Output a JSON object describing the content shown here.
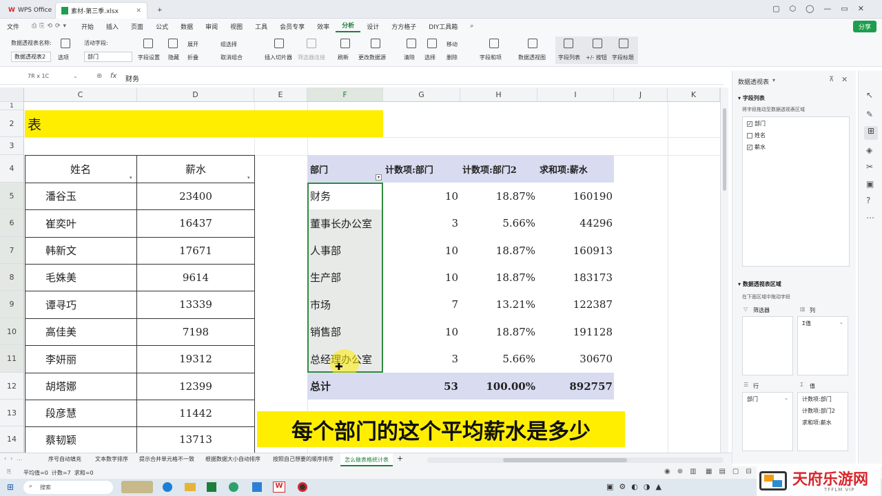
{
  "titlebar": {
    "wps_tab": "WPS Office",
    "file_tab": "素材-第三季.xlsx",
    "add": "+"
  },
  "menubar": {
    "file": "文件",
    "items": [
      "开始",
      "插入",
      "页面",
      "公式",
      "数据",
      "审阅",
      "视图",
      "工具",
      "会员专享",
      "效率",
      "分析",
      "设计",
      "方方格子",
      "DIY工具箱"
    ],
    "share": "分享"
  },
  "ribbon": {
    "pivot_name_label": "数据透视表名称:",
    "pivot_name_value": "数据透视表2",
    "options": "选项",
    "active_field_label": "活动字段:",
    "active_field_value": "部门",
    "field_settings": "字段设置",
    "hide": "隐藏",
    "expand": "展开",
    "collapse": "折叠",
    "group_select": "组选择",
    "ungroup": "取消组合",
    "insert_slicer": "插入切片器",
    "filter_conn": "筛选器连接",
    "refresh": "刷新",
    "change_source": "更改数据源",
    "clear": "清除",
    "select": "选择",
    "move": "移动",
    "delete": "删除",
    "fields_items": "字段和项",
    "pivot_chart": "数据透视图",
    "field_list": "字段列表",
    "plus_minus": "+/- 按钮",
    "field_headers": "字段标题"
  },
  "formula_bar": {
    "name_box": "7R x 1C",
    "fx": "fx",
    "content": "财务"
  },
  "columns": [
    "C",
    "D",
    "E",
    "F",
    "G",
    "H",
    "I",
    "J",
    "K"
  ],
  "rows": [
    "1",
    "2",
    "3",
    "4",
    "5",
    "6",
    "7",
    "8",
    "9",
    "10",
    "11",
    "12",
    "13",
    "14"
  ],
  "sheet": {
    "title_cell": "表",
    "left_headers": [
      "姓名",
      "薪水"
    ],
    "left_rows": [
      [
        "潘谷玉",
        "23400"
      ],
      [
        "崔奕叶",
        "16437"
      ],
      [
        "韩新文",
        "17671"
      ],
      [
        "毛姝美",
        "9614"
      ],
      [
        "谭寻巧",
        "13339"
      ],
      [
        "高佳美",
        "7198"
      ],
      [
        "李妍丽",
        "19312"
      ],
      [
        "胡塔娜",
        "12399"
      ],
      [
        "段彦慧",
        "11442"
      ],
      [
        "蔡韧颖",
        "13713"
      ]
    ],
    "pivot_headers": [
      "部门",
      "计数项:部门",
      "计数项:部门2",
      "求和项:薪水"
    ],
    "pivot_rows": [
      [
        "财务",
        "10",
        "18.87%",
        "160190"
      ],
      [
        "董事长办公室",
        "3",
        "5.66%",
        "44296"
      ],
      [
        "人事部",
        "10",
        "18.87%",
        "160913"
      ],
      [
        "生产部",
        "10",
        "18.87%",
        "183173"
      ],
      [
        "市场",
        "7",
        "13.21%",
        "122387"
      ],
      [
        "销售部",
        "10",
        "18.87%",
        "191128"
      ],
      [
        "总经理办公室",
        "3",
        "5.66%",
        "30670"
      ]
    ],
    "pivot_total": [
      "总计",
      "53",
      "100.00%",
      "892757"
    ]
  },
  "subtitle": "每个部门的这个平均薪水是多少",
  "right_panel": {
    "title": "数据透视表",
    "field_list_title": "字段列表",
    "field_list_hint": "将字段拖动至数据透视表区域",
    "fields": [
      {
        "name": "部门",
        "checked": true
      },
      {
        "name": "姓名",
        "checked": false
      },
      {
        "name": "薪水",
        "checked": true
      }
    ],
    "area_title": "数据透视表区域",
    "area_hint": "在下面区域中拖动字段",
    "filter_label": "筛选器",
    "col_label": "列",
    "col_value": "Σ值",
    "row_label": "行",
    "value_label": "值",
    "row_item": "部门",
    "value_items": [
      "计数项:部门",
      "计数项:部门2",
      "求和项:薪水"
    ]
  },
  "sheet_tabs": [
    "序号自动填充",
    "文本数字排序",
    "提示合并单元格不一致",
    "根据数据大小自动排序",
    "按照自己想要的顺序排序",
    "怎么做表格统计表"
  ],
  "status": {
    "text": "平均值=0  计数=7  求和=0"
  },
  "taskbar": {
    "search": "搜索"
  },
  "watermark": "天府乐游网",
  "watermark_sub": "TFFLM VIP",
  "colors": {
    "yellow": "#ffee00",
    "pivot_header": "#d9dcf0",
    "accent_green": "#1e7e3c"
  }
}
